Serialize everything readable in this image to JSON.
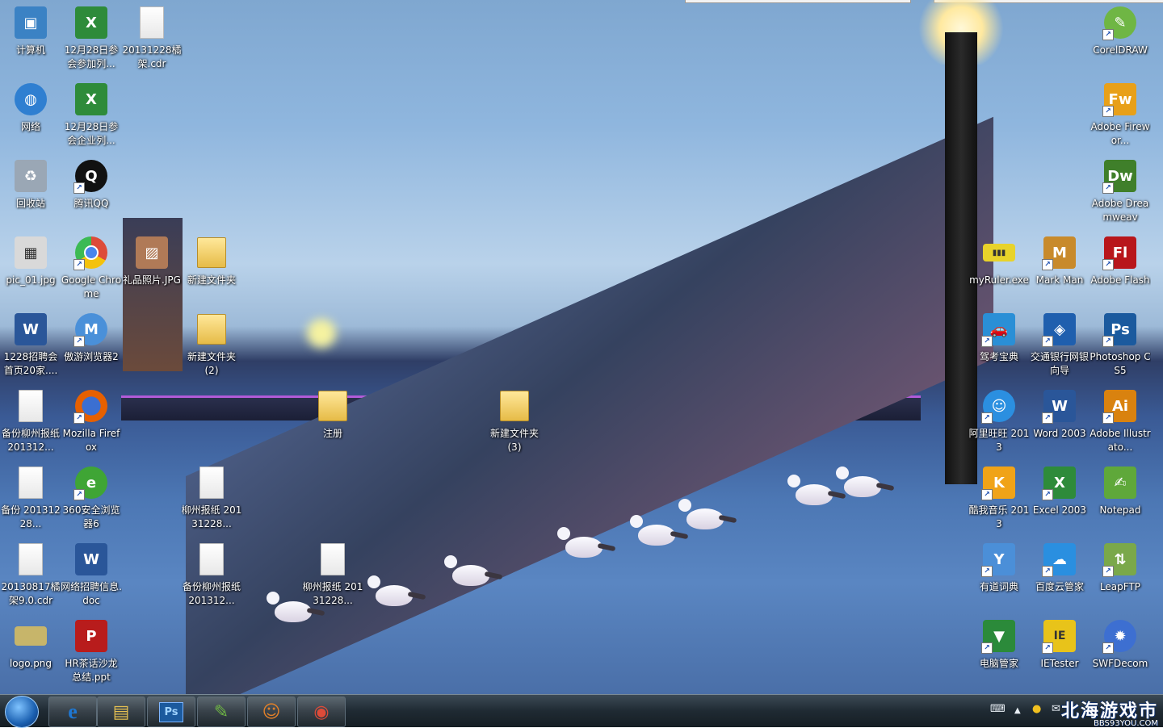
{
  "desktop": {
    "icons": [
      {
        "label": "计算机",
        "icon": "computer-icon",
        "color": "#3b82c4"
      },
      {
        "label": "12月28日参会参加列...",
        "icon": "excel-file-icon",
        "color": "#2e8b3a"
      },
      {
        "label": "20131228橘架.cdr",
        "icon": "blank-file-icon",
        "color": "#ffffff"
      },
      {
        "label": "网络",
        "icon": "network-globe-icon",
        "color": "#2f7fd1"
      },
      {
        "label": "12月28日参会企业列...",
        "icon": "excel-file-icon",
        "color": "#2e8b3a"
      },
      {
        "label": "回收站",
        "icon": "recycle-bin-icon",
        "color": "#9aa7b5"
      },
      {
        "label": "腾讯QQ",
        "icon": "qq-penguin-icon",
        "color": "#111111"
      },
      {
        "label": "pic_01.jpg",
        "icon": "image-file-icon",
        "color": "#d9d9d9"
      },
      {
        "label": "Google Chrome",
        "icon": "chrome-icon",
        "color": "#dd4b39"
      },
      {
        "label": "礼品照片.JPG",
        "icon": "photo-file-icon",
        "color": "#b07a57"
      },
      {
        "label": "新建文件夹",
        "icon": "folder-icon",
        "color": "#f0c650"
      },
      {
        "label": "1228招聘会首页20家....",
        "icon": "word-file-icon",
        "color": "#2a5699"
      },
      {
        "label": "傲游浏览器2",
        "icon": "maxthon-icon",
        "color": "#4a90d9"
      },
      {
        "label": "新建文件夹 (2)",
        "icon": "folder-icon",
        "color": "#f0c650"
      },
      {
        "label": "备份柳州报纸201312...",
        "icon": "blank-file-icon",
        "color": "#ffffff"
      },
      {
        "label": "Mozilla Firefox",
        "icon": "firefox-icon",
        "color": "#e66000"
      },
      {
        "label": "注册",
        "icon": "folder-icon",
        "color": "#f0c650"
      },
      {
        "label": "新建文件夹 (3)",
        "icon": "folder-icon",
        "color": "#f0c650"
      },
      {
        "label": "备份 20131228...",
        "icon": "blank-file-icon",
        "color": "#ffffff"
      },
      {
        "label": "360安全浏览器6",
        "icon": "browser-360-icon",
        "color": "#3fa535"
      },
      {
        "label": "柳州报纸 20131228...",
        "icon": "blank-file-icon",
        "color": "#ffffff"
      },
      {
        "label": "20130817橘架9.0.cdr",
        "icon": "blank-file-icon",
        "color": "#ffffff"
      },
      {
        "label": "网络招聘信息.doc",
        "icon": "word-file-icon",
        "color": "#2a5699"
      },
      {
        "label": "备份柳州报纸201312...",
        "icon": "blank-file-icon",
        "color": "#ffffff"
      },
      {
        "label": "柳州报纸 20131228...",
        "icon": "blank-file-icon",
        "color": "#ffffff"
      },
      {
        "label": "logo.png",
        "icon": "logo-image-icon",
        "color": "#c7b56a"
      },
      {
        "label": "HR茶话沙龙总结.ppt",
        "icon": "ppt-file-icon",
        "color": "#b81c1c"
      },
      {
        "label": "CorelDRAW",
        "icon": "coreldraw-icon",
        "color": "#6fb644"
      },
      {
        "label": "Adobe Firewor...",
        "icon": "fireworks-icon",
        "color": "#e8a019"
      },
      {
        "label": "Adobe Dreamweav",
        "icon": "dreamweaver-icon",
        "color": "#3f7f2a"
      },
      {
        "label": "myRuler.exe",
        "icon": "ruler-icon",
        "color": "#e8d32a"
      },
      {
        "label": "Mark Man",
        "icon": "markman-icon",
        "color": "#c88a2b"
      },
      {
        "label": "Adobe Flash",
        "icon": "flash-icon",
        "color": "#b8161b"
      },
      {
        "label": "驾考宝典",
        "icon": "car-icon",
        "color": "#2a8fd6"
      },
      {
        "label": "交通银行网银向导",
        "icon": "bank-icon",
        "color": "#1f5fae"
      },
      {
        "label": "Photoshop CS5",
        "icon": "photoshop-icon",
        "color": "#1b5a9e"
      },
      {
        "label": "阿里旺旺 2013",
        "icon": "aliwangwang-icon",
        "color": "#2b8fe0"
      },
      {
        "label": "Word 2003",
        "icon": "word-icon",
        "color": "#2a5699"
      },
      {
        "label": "Adobe Illustrato...",
        "icon": "illustrator-icon",
        "color": "#d9820f"
      },
      {
        "label": "酷我音乐 2013",
        "icon": "kuwo-music-icon",
        "color": "#f0a318"
      },
      {
        "label": "Excel 2003",
        "icon": "excel-icon",
        "color": "#2e8b3a"
      },
      {
        "label": "Notepad",
        "icon": "notepad-icon",
        "color": "#5fa83a"
      },
      {
        "label": "有道词典",
        "icon": "youdao-dict-icon",
        "color": "#4b8fd8"
      },
      {
        "label": "百度云管家",
        "icon": "baidu-cloud-icon",
        "color": "#2a8fe0"
      },
      {
        "label": "LeapFTP",
        "icon": "leapftp-icon",
        "color": "#7aa84a"
      },
      {
        "label": "电脑管家",
        "icon": "pc-manager-icon",
        "color": "#2b8a3a"
      },
      {
        "label": "IETester",
        "icon": "ietester-icon",
        "color": "#e8c31a"
      },
      {
        "label": "SWFDecom",
        "icon": "swfdecompiler-icon",
        "color": "#3d6fd1"
      }
    ]
  },
  "taskbar": {
    "start_label": "Start",
    "apps": [
      {
        "name": "Internet Explorer",
        "icon": "ie-icon",
        "glyph": "e",
        "color": "#1e77d2"
      },
      {
        "name": "Windows Explorer",
        "icon": "explorer-icon",
        "glyph": "▤",
        "color": "#e5c052"
      },
      {
        "name": "Photoshop",
        "icon": "photoshop-icon",
        "glyph": "Ps",
        "color": "#1b5a9e"
      },
      {
        "name": "CorelDRAW",
        "icon": "coreldraw-icon",
        "glyph": "✎",
        "color": "#6fb644"
      },
      {
        "name": "Game",
        "icon": "cartoon-face-icon",
        "glyph": "☺",
        "color": "#e0802a"
      },
      {
        "name": "Google Chrome",
        "icon": "chrome-icon",
        "glyph": "◉",
        "color": "#dd4b39"
      }
    ],
    "tray": {
      "keyboard_icon": "⌨",
      "arrow_icon": "▲",
      "qq_icon": "●",
      "msg_icon": "✉"
    },
    "watermark": {
      "line1": "北海游戏市",
      "line2": "BBS93YOU.COM"
    }
  }
}
